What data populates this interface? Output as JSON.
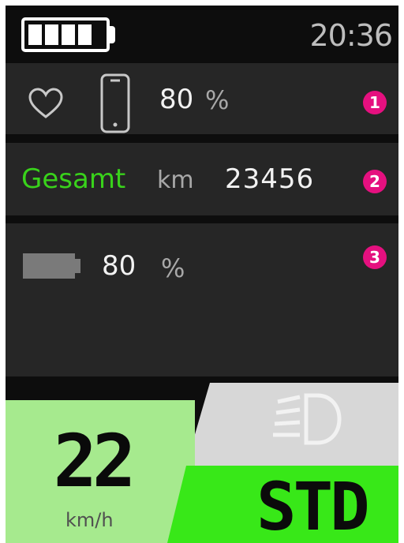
{
  "status": {
    "time": "20:36",
    "battery_level": 1.0
  },
  "row1": {
    "value": "80",
    "unit": "%",
    "badge": "1"
  },
  "row2": {
    "label": "Gesamt",
    "unit": "km",
    "value": "23456",
    "badge": "2"
  },
  "row3": {
    "value": "80",
    "unit": "%",
    "badge": "3"
  },
  "speed": {
    "value": "22",
    "unit": "km/h"
  },
  "mode": {
    "label": "STD"
  },
  "colors": {
    "accent_green": "#38e818",
    "label_green": "#39d21b",
    "speed_panel": "#a6ea8e",
    "badge": "#e5107f",
    "row_bg": "#262626"
  },
  "icons": [
    "battery-icon",
    "heart-icon",
    "phone-icon",
    "battery-bar-icon",
    "headlight-icon"
  ]
}
